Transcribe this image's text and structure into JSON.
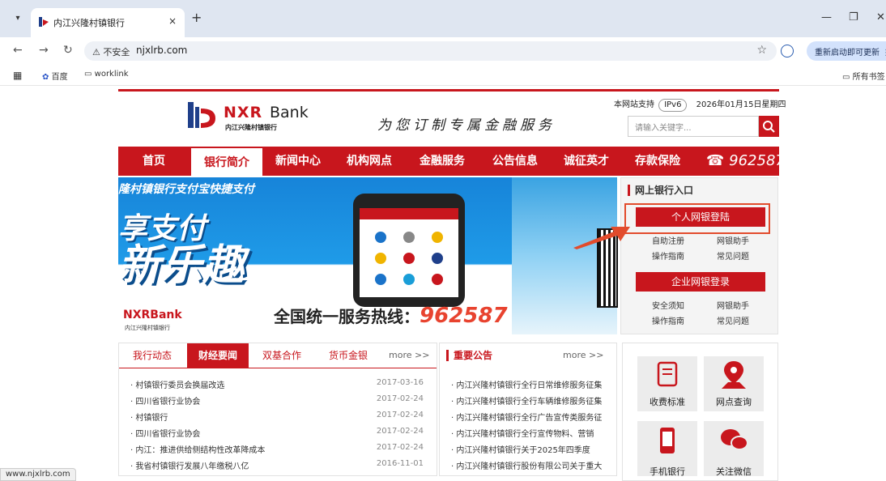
{
  "browser": {
    "tab_title": "内江兴隆村镇银行",
    "tab_close": "×",
    "new_tab": "+",
    "security_label": "不安全",
    "url": "njxlrb.com",
    "update_button": "重新启动即可更新",
    "bookmarks": [
      "百度",
      "worklink"
    ],
    "all_bookmarks": "所有书签",
    "status_url": "www.njxlrb.com"
  },
  "header": {
    "logo_nxr": "NXR",
    "logo_bank": "Bank",
    "logo_cn": "内江兴隆村镇银行",
    "slogan": "为您订制专属金融服务",
    "ipv6_prefix": "本网站支持",
    "ipv6_badge": "IPv6",
    "date": "2026年01月15日星期四",
    "search_placeholder": "请输入关键字..."
  },
  "nav": {
    "items": [
      "首页",
      "银行简介",
      "新闻中心",
      "机构网点",
      "金融服务",
      "公告信息",
      "诚征英才",
      "存款保险"
    ],
    "active_index": 1,
    "phone": "962587"
  },
  "banner": {
    "top_text": "隆村镇银行支付宝快捷支付",
    "big1": "享支付",
    "big2": "新乐趣",
    "brand": "NXRBank",
    "brand_cn": "内江兴隆村镇银行",
    "hotline_label": "全国统一服务热线：",
    "hotline_number": "962587"
  },
  "ebank": {
    "title": "网上银行入口",
    "personal_button": "个人网银登陆",
    "personal_links": [
      "自助注册",
      "网银助手",
      "操作指南",
      "常见问题"
    ],
    "corporate_button": "企业网银登录",
    "corporate_links": [
      "安全须知",
      "网银助手",
      "操作指南",
      "常见问题"
    ]
  },
  "news": {
    "tabs": [
      "我行动态",
      "财经要闻",
      "双基合作",
      "货币金银"
    ],
    "active_index": 1,
    "more": "more >>",
    "rows": [
      {
        "title": "· 村镇银行委员会换届改选",
        "date": "2017-03-16"
      },
      {
        "title": "· 四川省银行业协会",
        "date": "2017-02-24"
      },
      {
        "title": "· 村镇银行",
        "date": "2017-02-24"
      },
      {
        "title": "· 四川省银行业协会",
        "date": "2017-02-24"
      },
      {
        "title": "· 内江：推进供给侧结构性改革降成本",
        "date": "2017-02-24"
      },
      {
        "title": "· 我省村镇银行发展八年缴税八亿",
        "date": "2016-11-01"
      }
    ]
  },
  "notice": {
    "title": "重要公告",
    "more": "more >>",
    "rows": [
      "· 内江兴隆村镇银行全行日常维修服务征集",
      "· 内江兴隆村镇银行全行车辆维修服务征集",
      "· 内江兴隆村镇银行全行广告宣传类服务征",
      "· 内江兴隆村镇银行全行宣传物料、营销",
      "· 内江兴隆村镇银行关于2025年四季度",
      "· 内江兴隆村镇银行股份有限公司关于重大"
    ]
  },
  "services": {
    "items": [
      "收费标准",
      "网点查询",
      "手机银行",
      "关注微信"
    ],
    "colors": {
      "accent": "#c8161d"
    }
  }
}
